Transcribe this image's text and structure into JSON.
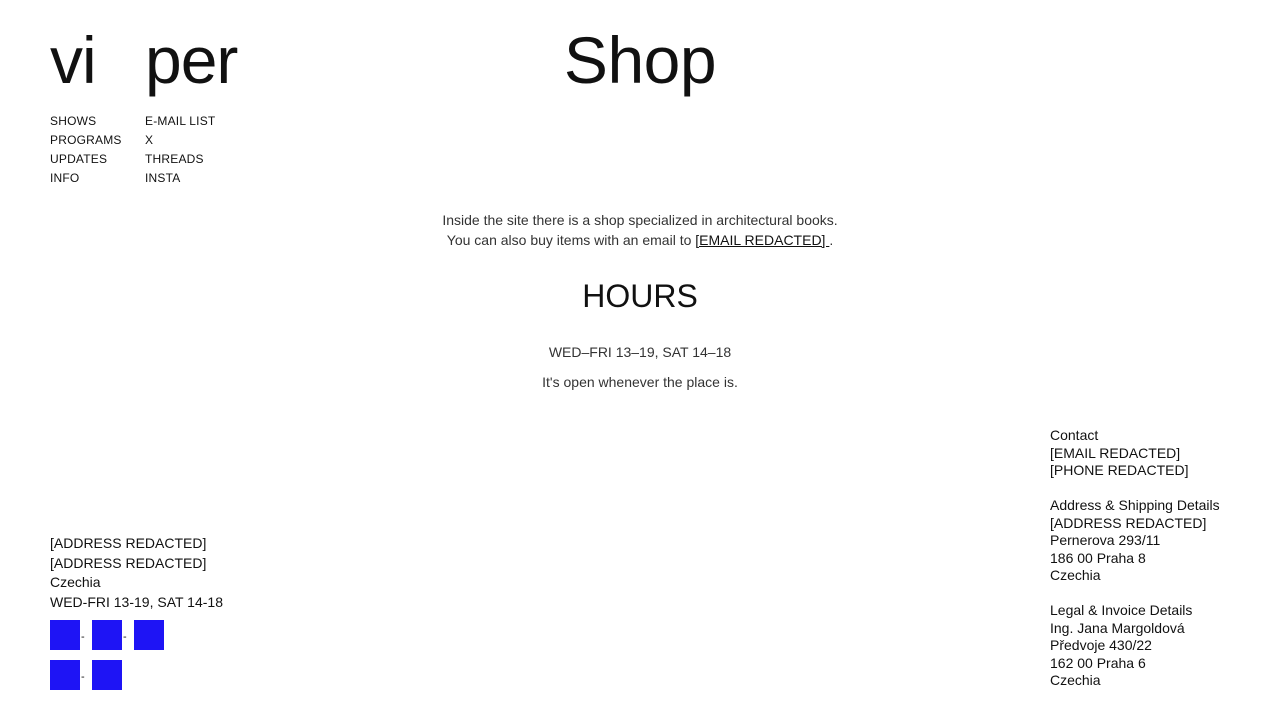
{
  "logo": {
    "part1": "vi",
    "part2": "per"
  },
  "nav_left": [
    "SHOWS",
    "PROGRAMS",
    "UPDATES",
    "INFO"
  ],
  "nav_right": [
    "E-MAIL LIST",
    "X",
    "THREADS",
    "INSTA"
  ],
  "page_title": "Shop",
  "intro": {
    "line1": "Inside the site there is a shop specialized in architectural books.",
    "line2_prefix": "You can also buy items with an email to ",
    "email_link": "[EMAIL REDACTED] ",
    "line2_suffix": "."
  },
  "hours": {
    "title": "HOURS",
    "schedule": "WED–FRI 13–19, SAT 14–18",
    "note": "It's open whenever the place is."
  },
  "footer_left": {
    "address_line1": "[ADDRESS REDACTED]",
    "address_line2": "[ADDRESS REDACTED]",
    "country": "Czechia",
    "hours": "WED-FRI 13-19, SAT 14-18",
    "social_color": "#1e14f5",
    "social_separator": "-"
  },
  "contact": {
    "heading": "Contact",
    "email": "[EMAIL REDACTED]",
    "phone": "[PHONE REDACTED]"
  },
  "shipping": {
    "heading": "Address & Shipping Details",
    "line1": "[ADDRESS REDACTED]",
    "line2": "Pernerova 293/11",
    "line3": "186 00 Praha 8",
    "line4": "Czechia"
  },
  "legal": {
    "heading": "Legal & Invoice Details",
    "line1": "Ing. Jana Margoldová",
    "line2": "Předvoje 430/22",
    "line3": "162 00 Praha 6",
    "line4": "Czechia"
  }
}
